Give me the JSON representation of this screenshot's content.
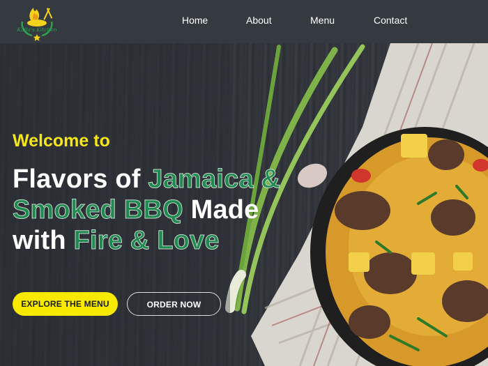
{
  "brand": {
    "logo_text": "Kaila's Kitchen",
    "logo_colors": {
      "flame": "#f7d21a",
      "leaf": "#2e9e4f",
      "star": "#f7d21a"
    }
  },
  "nav": {
    "items": [
      {
        "label": "Home"
      },
      {
        "label": "About"
      },
      {
        "label": "Menu"
      },
      {
        "label": "Contact"
      }
    ]
  },
  "hero": {
    "welcome": "Welcome to",
    "headline": {
      "part1": "Flavors of ",
      "part2": "Jamaica &",
      "part3": "Smoked BBQ",
      "part4": " Made",
      "part5": "with ",
      "part6": "Fire & Love"
    },
    "cta_primary": "EXPLORE THE MENU",
    "cta_secondary": "ORDER NOW"
  },
  "colors": {
    "header_bg": "#343a40",
    "accent_yellow": "#f7ea00",
    "accent_green": "#1e8a4f",
    "text_white": "#ffffff"
  }
}
